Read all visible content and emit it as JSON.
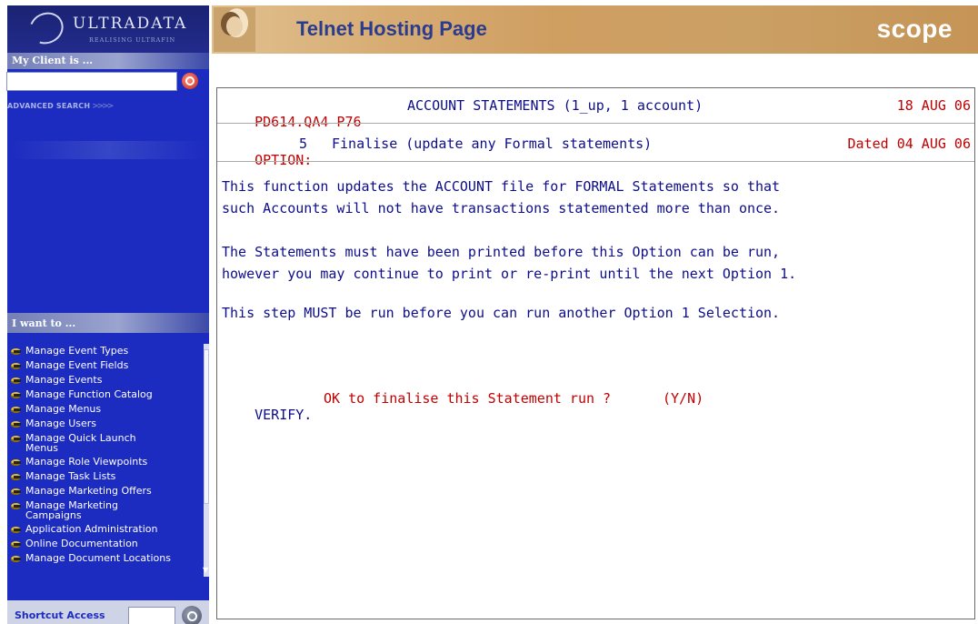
{
  "sidebar": {
    "logo_text": "ULTRADATA",
    "logo_tagline": "REALISING ULTRAFIN",
    "client_heading": "My Client is ...",
    "search_value": "",
    "advanced_search": "ADVANCED SEARCH",
    "advanced_arrows": ">>>>",
    "want_heading": "I want to ...",
    "menu_items": [
      "Manage Event Types",
      "Manage Event Fields",
      "Manage Events",
      "Manage Function Catalog",
      "Manage Menus",
      "Manage Users",
      "Manage Quick Launch Menus",
      "Manage Role Viewpoints",
      "Manage Task Lists",
      "Manage Marketing Offers",
      "Manage Marketing Campaigns",
      "Application Administration",
      "Online Documentation",
      "Manage Document Locations"
    ],
    "shortcut_label": "Shortcut Access",
    "shortcut_value": ""
  },
  "header": {
    "title": "Telnet Hosting Page",
    "brand": "scope"
  },
  "terminal": {
    "program_id": "PD614.QA4 P76",
    "screen_title": "ACCOUNT STATEMENTS (1_up, 1 account)",
    "date": "18 AUG 06",
    "option_label": "OPTION:",
    "option_number": "5",
    "option_desc": "Finalise (update any Formal statements)",
    "dated_label": "Dated",
    "dated_value": "04 AUG 06",
    "lines": [
      "This function updates the ACCOUNT file for FORMAL Statements so that",
      "such Accounts will not have transactions statemented more than once.",
      "",
      "The Statements must have been printed before this Option can be run,",
      "however you may continue to print or re-print until the next Option 1.",
      "",
      "This step MUST be run before you can run another Option 1 Selection."
    ],
    "verify_label": "VERIFY.",
    "verify_prompt": "OK to finalise this Statement run ?",
    "verify_options": "(Y/N)"
  },
  "colors": {
    "sidebar_bg": "#1c2bc0",
    "terminal_red": "#c20000",
    "terminal_blue": "#0d0d8a",
    "header_title": "#2a3c8f"
  }
}
